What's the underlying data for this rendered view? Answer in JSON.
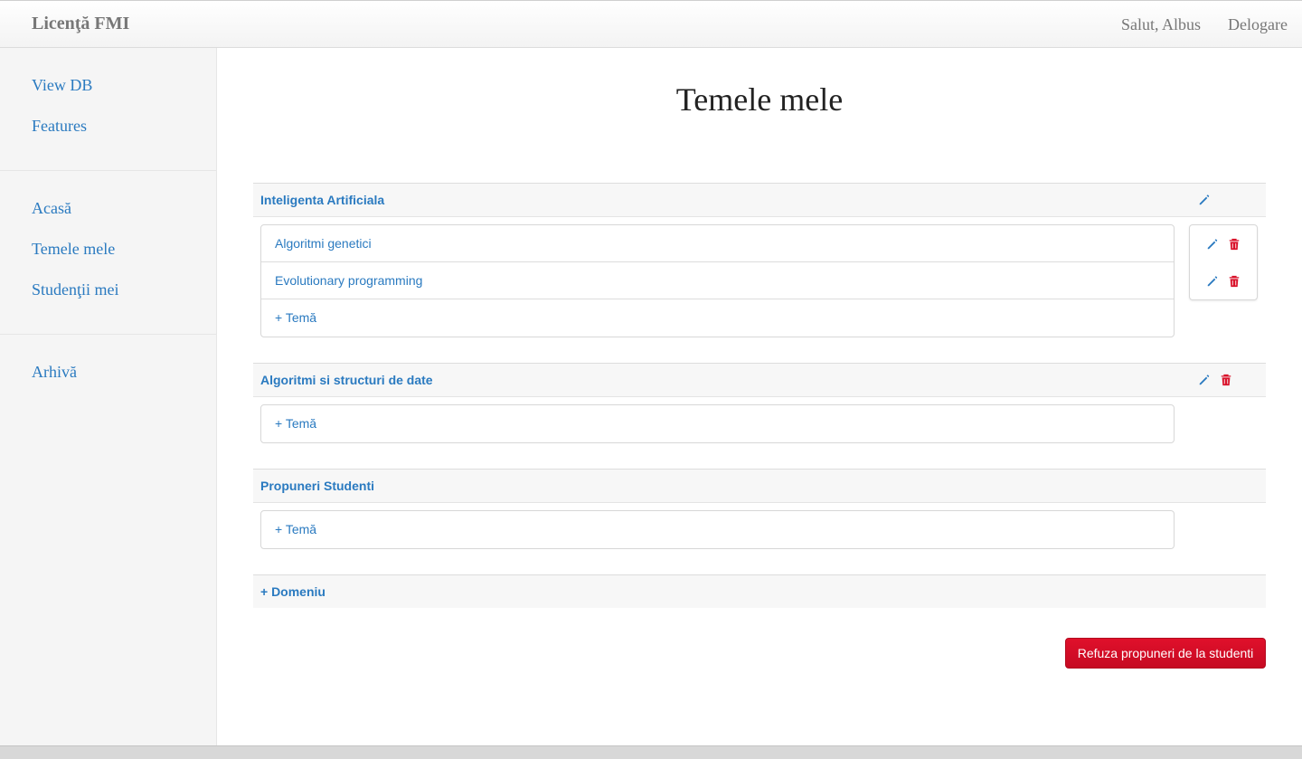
{
  "header": {
    "brand": "Licenţă FMI",
    "greeting": "Salut, Albus",
    "logout": "Delogare"
  },
  "sidebar": {
    "groups": [
      [
        "View DB",
        "Features"
      ],
      [
        "Acasă",
        "Temele mele",
        "Studenţii mei"
      ],
      [
        "Arhivă"
      ]
    ]
  },
  "main": {
    "title": "Temele mele",
    "domains": [
      {
        "name": "Inteligenta Artificiala",
        "topics": [
          "Algoritmi genetici",
          "Evolutionary programming"
        ],
        "add_topic": "+ Temă"
      },
      {
        "name": "Algoritmi si structuri de date",
        "topics": [],
        "add_topic": "+ Temă"
      },
      {
        "name": "Propuneri Studenti",
        "topics": [],
        "add_topic": "+ Temă"
      }
    ],
    "add_domain": "+ Domeniu",
    "refuse_button": "Refuza propuneri de la studenti"
  },
  "icons": {
    "edit": "pencil-icon",
    "delete": "trash-icon"
  },
  "colors": {
    "link": "#2a7ac0",
    "danger": "#d9122a"
  }
}
